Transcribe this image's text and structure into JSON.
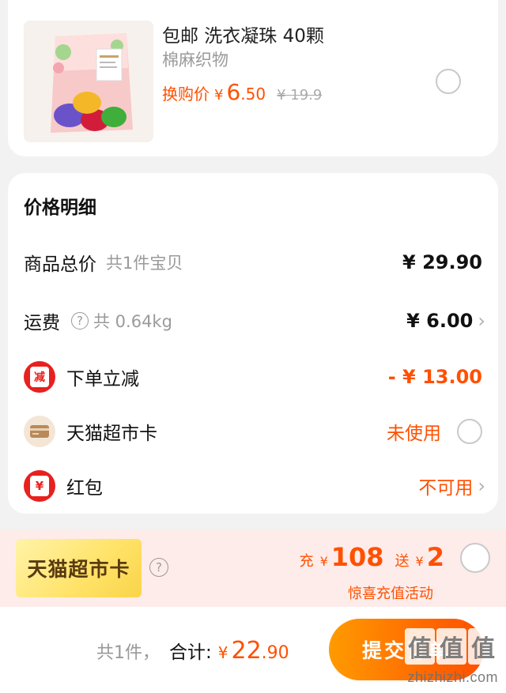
{
  "product": {
    "title": "包邮 洗衣凝珠 40颗",
    "subtitle": "棉麻织物",
    "price_label": "换购价",
    "currency": "¥",
    "price_int": "6",
    "price_dec": ".50",
    "original_price": "¥ 19.9"
  },
  "details": {
    "title": "价格明细",
    "rows": [
      {
        "label": "商品总价",
        "sub": "共1件宝贝",
        "value": "¥ 29.90"
      },
      {
        "label": "运费",
        "help": "?",
        "sub": "共 0.64kg",
        "value": "¥ 6.00"
      },
      {
        "label": "下单立减",
        "icon_char": "减",
        "value": "- ¥ 13.00"
      },
      {
        "label": "天猫超市卡",
        "value": "未使用"
      },
      {
        "label": "红包",
        "icon_char": "¥",
        "value": "不可用"
      }
    ],
    "chevron": "›"
  },
  "tmall_card": {
    "badge": "天猫超市卡",
    "help": "?",
    "recharge_label": "充",
    "recharge_currency": "¥",
    "recharge_amount": "108",
    "bonus_label": "送",
    "bonus_currency": "¥",
    "bonus_amount": "2",
    "promo_text": "惊喜充值活动"
  },
  "bottom": {
    "count_text": "共1件，",
    "total_label": "合计:",
    "currency": "¥",
    "total_int": "22",
    "total_dec": ".90",
    "submit_label": "提交订单"
  },
  "watermark": {
    "logo_chars": [
      "值",
      "值",
      "值"
    ],
    "site": "zhizhizhi.com"
  },
  "colors": {
    "accent": "#ff5000",
    "red_icon": "#e8201e",
    "muted": "#9a9a9a"
  }
}
